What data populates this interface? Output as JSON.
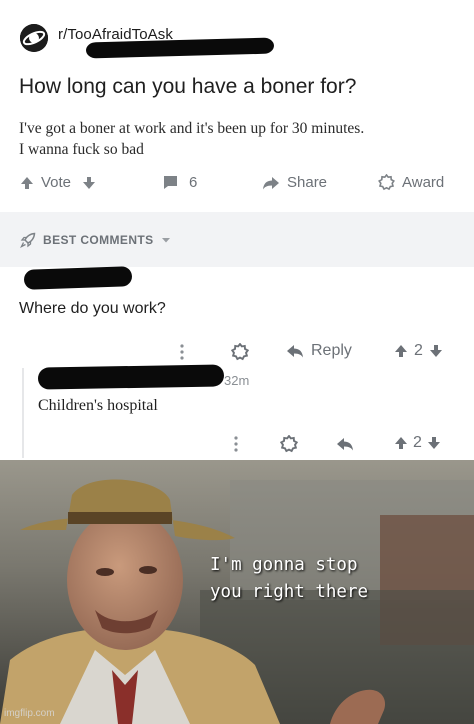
{
  "post": {
    "subreddit": "r/TooAfraidToAsk",
    "title": "How long can you have a boner for?",
    "body_line1": "I've got a boner at work and it's been up for 30 minutes.",
    "body_line2": "I wanna fuck so bad",
    "actions": {
      "vote_label": "Vote",
      "comments_count": "6",
      "share_label": "Share",
      "award_label": "Award"
    }
  },
  "comments_header": {
    "label": "BEST COMMENTS"
  },
  "comment1": {
    "text": "Where do you work?",
    "reply_label": "Reply",
    "score": "2"
  },
  "comment2": {
    "time": "32m",
    "text": "Children's hospital",
    "score": "2"
  },
  "meme": {
    "line1": "I'm gonna stop",
    "line2": "you right there",
    "watermark": "imgflip.com"
  },
  "colors": {
    "meta_gray": "#6c7177",
    "bar_bg": "#f2f3f5"
  }
}
